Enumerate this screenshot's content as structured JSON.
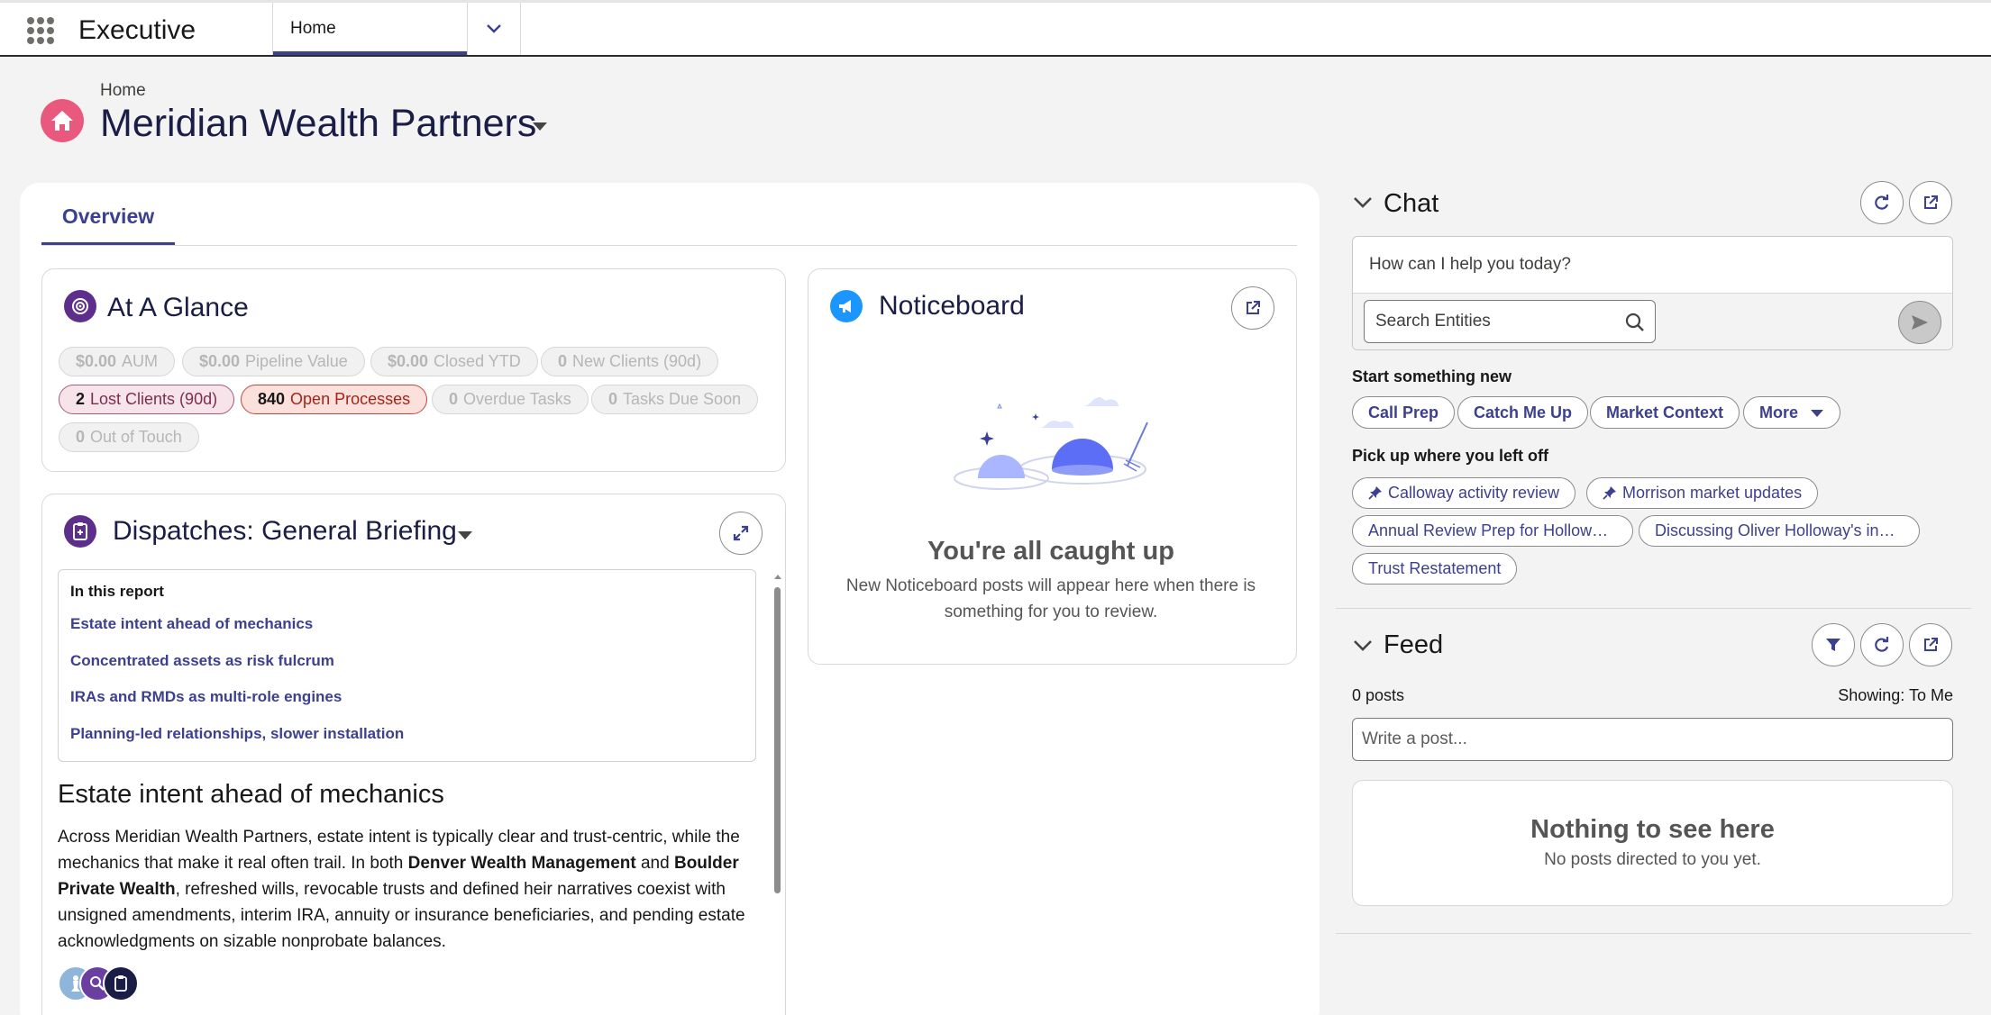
{
  "app": {
    "name": "Executive",
    "nav_tab": "Home"
  },
  "page": {
    "breadcrumb": "Home",
    "title": "Meridian Wealth Partners"
  },
  "tabs": {
    "overview": "Overview"
  },
  "glance": {
    "title": "At A Glance",
    "pills": [
      {
        "value": "$0.00",
        "label": "AUM",
        "state": "muted"
      },
      {
        "value": "$0.00",
        "label": "Pipeline Value",
        "state": "muted"
      },
      {
        "value": "$0.00",
        "label": "Closed YTD",
        "state": "muted"
      },
      {
        "value": "0",
        "label": "New Clients (90d)",
        "state": "muted"
      },
      {
        "value": "2",
        "label": "Lost Clients (90d)",
        "state": "lost"
      },
      {
        "value": "840",
        "label": "Open Processes",
        "state": "alert"
      },
      {
        "value": "0",
        "label": "Overdue Tasks",
        "state": "muted"
      },
      {
        "value": "0",
        "label": "Tasks Due Soon",
        "state": "muted"
      },
      {
        "value": "0",
        "label": "Out of Touch",
        "state": "muted"
      }
    ]
  },
  "dispatches": {
    "title": "Dispatches: General Briefing",
    "toc_heading": "In this report",
    "toc": [
      "Estate intent ahead of mechanics",
      "Concentrated assets as risk fulcrum",
      "IRAs and RMDs as multi-role engines",
      "Planning-led relationships, slower installation"
    ],
    "article": {
      "heading": "Estate intent ahead of mechanics",
      "p_1": "Across Meridian Wealth Partners, estate intent is typically clear and trust-centric, while the mechanics that make it real often trail. In both ",
      "bold_1": "Denver Wealth Management",
      "p_2": " and ",
      "bold_2": "Boulder Private Wealth",
      "p_3": ", refreshed wills, revocable trusts and defined heir narratives coexist with unsigned amendments, interim IRA, annuity or insurance beneficiaries, and pending estate acknowledgments on sizable nonprobate balances."
    }
  },
  "noticeboard": {
    "title": "Noticeboard",
    "empty_heading": "You're all caught up",
    "empty_text": "New Noticeboard posts will appear here when there is something for you to review."
  },
  "chat": {
    "title": "Chat",
    "prompt": "How can I help you today?",
    "search_placeholder": "Search Entities",
    "start_heading": "Start something new",
    "quick_actions": [
      "Call Prep",
      "Catch Me Up",
      "Market Context",
      "More"
    ],
    "resume_heading": "Pick up where you left off",
    "recent": [
      {
        "label": "Calloway activity review",
        "pinned": true
      },
      {
        "label": "Morrison market updates",
        "pinned": true
      },
      {
        "label": "Annual Review Prep for Hollowa…",
        "pinned": false
      },
      {
        "label": "Discussing Oliver Holloway's inh…",
        "pinned": false
      },
      {
        "label": "Trust Restatement",
        "pinned": false
      }
    ]
  },
  "feed": {
    "title": "Feed",
    "count": "0 posts",
    "showing": "Showing: To Me",
    "post_placeholder": "Write a post...",
    "empty_heading": "Nothing to see here",
    "empty_text": "No posts directed to you yet."
  },
  "colors": {
    "brand": "#3d3f8f",
    "home_icon": "#e9597e",
    "glance_icon": "#5d2e8c",
    "dispatch_icon": "#5d2e8c",
    "noticeboard_icon": "#1b96ff",
    "lost_pill": "#f7e3ea",
    "alert_pill": "#fbe0dc"
  },
  "icons": {
    "launcher": "app-launcher-icon",
    "home": "home-icon",
    "glance": "target-icon",
    "dispatch": "clipboard-icon",
    "noticeboard": "megaphone-icon",
    "expand": "expand-icon",
    "popout": "new-window-icon",
    "refresh": "refresh-icon",
    "filter": "filter-icon",
    "search": "search-icon",
    "send": "send-icon",
    "pin": "pin-icon"
  }
}
